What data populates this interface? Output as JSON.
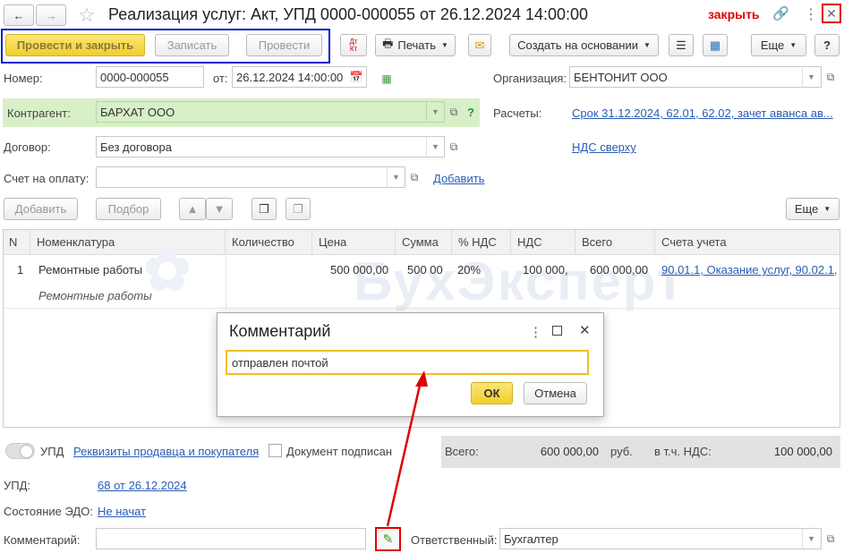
{
  "window": {
    "title": "Реализация услуг: Акт, УПД 0000-000055 от 26.12.2024 14:00:00",
    "close_label": "закрыть"
  },
  "toolbar": {
    "post_close": "Провести и закрыть",
    "save": "Записать",
    "post": "Провести",
    "dt_kt": "Дт Кт",
    "print": "Печать",
    "create_based": "Создать на основании",
    "more": "Еще",
    "help": "?"
  },
  "form": {
    "number_label": "Номер:",
    "number_value": "0000-000055",
    "from_label": "от:",
    "date_value": "26.12.2024 14:00:00",
    "org_label": "Организация:",
    "org_value": "БЕНТОНИТ ООО",
    "counterparty_label": "Контрагент:",
    "counterparty_value": "БАРХАТ ООО",
    "settlements_label": "Расчеты:",
    "settlements_link": "Срок 31.12.2024, 62.01, 62.02, зачет аванса ав...",
    "contract_label": "Договор:",
    "contract_value": "Без договора",
    "vat_link": "НДС сверху",
    "invoice_label": "Счет на оплату:",
    "add_link": "Добавить"
  },
  "table_toolbar": {
    "add": "Добавить",
    "pick": "Подбор",
    "more": "Еще"
  },
  "table": {
    "headers": [
      "N",
      "Номенклатура",
      "Количество",
      "Цена",
      "Сумма",
      "% НДС",
      "НДС",
      "Всего",
      "Счета учета"
    ],
    "rows": [
      {
        "n": "1",
        "name": "Ремонтные работы",
        "subname": "Ремонтные работы",
        "qty": "",
        "price": "500 000,00",
        "sum": "500 00",
        "vat_rate": "20%",
        "vat": "100 000,",
        "total": "600 000,00",
        "accounts": "90.01.1, Оказание услуг, 90.02.1,"
      }
    ]
  },
  "watermark": "БухЭксперт",
  "dialog": {
    "title": "Комментарий",
    "value": "отправлен почтой",
    "ok": "ОК",
    "cancel": "Отмена"
  },
  "footer": {
    "upd_label": "УПД",
    "requisites_link": "Реквизиты продавца и покупателя",
    "signed_label": "Документ подписан",
    "total_label": "Всего:",
    "total_value": "600 000,00",
    "currency": "руб.",
    "vat_incl_label": "в т.ч. НДС:",
    "vat_value": "100 000,00",
    "upd_field_label": "УПД:",
    "upd_link": "68 от 26.12.2024",
    "edo_label": "Состояние ЭДО:",
    "edo_link": "Не начат",
    "comment_label": "Комментарий:",
    "comment_value": "",
    "responsible_label": "Ответственный:",
    "responsible_value": "Бухгалтер"
  },
  "colors": {
    "highlight_green": "#d8efc8",
    "accent_yellow": "#f1cf2c",
    "link_blue": "#2a5bb5",
    "annotation_red": "#e00000",
    "annotation_blue": "#0a1fd0"
  }
}
